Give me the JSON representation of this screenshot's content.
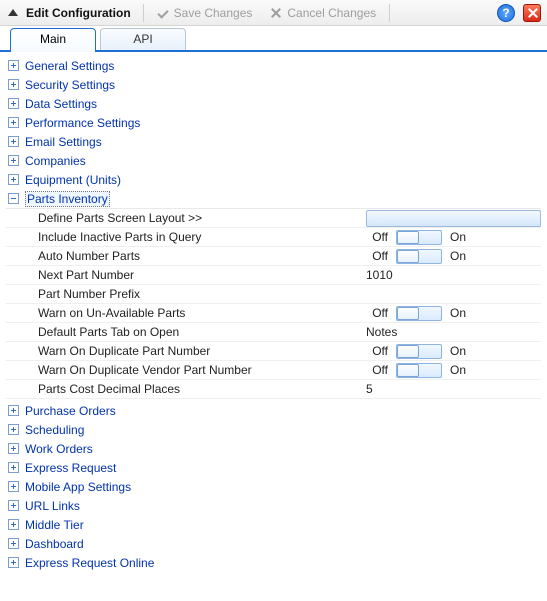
{
  "toolbar": {
    "title": "Edit Configuration",
    "save_label": "Save Changes",
    "cancel_label": "Cancel Changes"
  },
  "tabs": {
    "main": "Main",
    "api": "API",
    "active": "Main"
  },
  "sections": {
    "general": "General Settings",
    "security": "Security Settings",
    "data": "Data Settings",
    "performance": "Performance Settings",
    "email": "Email Settings",
    "companies": "Companies",
    "equipment": "Equipment (Units)",
    "parts_inventory": "Parts Inventory",
    "purchase_orders": "Purchase Orders",
    "scheduling": "Scheduling",
    "work_orders": "Work Orders",
    "express_request": "Express Request",
    "mobile_app": "Mobile App Settings",
    "url_links": "URL Links",
    "middle_tier": "Middle Tier",
    "dashboard": "Dashboard",
    "express_request_online": "Express Request Online"
  },
  "toggle_labels": {
    "off": "Off",
    "on": "On"
  },
  "parts_inventory": {
    "rows": {
      "define_layout": {
        "label": "Define Parts Screen Layout >>"
      },
      "include_inactive": {
        "label": "Include Inactive Parts in Query",
        "value": false
      },
      "auto_number": {
        "label": "Auto Number Parts",
        "value": false
      },
      "next_part_number": {
        "label": "Next Part Number",
        "value": "1010"
      },
      "part_number_prefix": {
        "label": "Part Number Prefix",
        "value": ""
      },
      "warn_unavailable": {
        "label": "Warn on Un-Available Parts",
        "value": false
      },
      "default_tab": {
        "label": "Default Parts Tab on Open",
        "value": "Notes"
      },
      "warn_dup_part": {
        "label": "Warn On Duplicate Part Number",
        "value": false
      },
      "warn_dup_vendor": {
        "label": "Warn On Duplicate Vendor Part Number",
        "value": false
      },
      "cost_decimals": {
        "label": "Parts Cost Decimal Places",
        "value": "5"
      }
    }
  }
}
